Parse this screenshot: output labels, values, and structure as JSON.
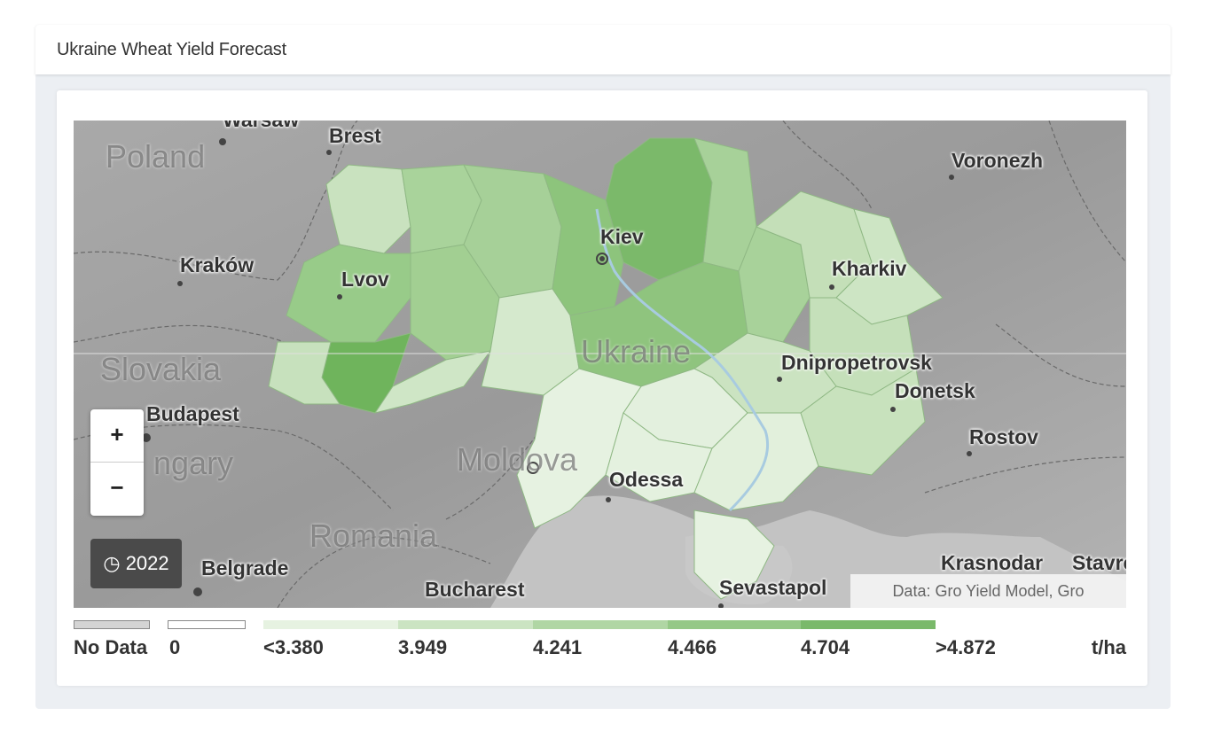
{
  "panel": {
    "title": "Ukraine Wheat Yield Forecast"
  },
  "map": {
    "zoom_in_label": "+",
    "zoom_out_label": "−",
    "year_icon": "clock-icon",
    "year_icon_glyph": "◷",
    "year": "2022",
    "attribution": "Data: Gro Yield Model, Gro",
    "cities": {
      "warsaw": "Warsaw",
      "brest": "Brest",
      "voronezh": "Voronezh",
      "kiev": "Kiev",
      "krakow": "Kraków",
      "lvov": "Lvov",
      "kharkiv": "Kharkiv",
      "dnipropetrovsk": "Dnipropetrovsk",
      "donetsk": "Donetsk",
      "budapest": "Budapest",
      "rostov": "Rostov",
      "odessa": "Odessa",
      "belgrade": "Belgrade",
      "bucharest": "Bucharest",
      "sevastapol": "Sevastapol",
      "krasnodar": "Krasnodar",
      "stavropol": "Stavrc"
    },
    "countries": {
      "poland": "Poland",
      "slovakia": "Slovakia",
      "hungary": "ngary",
      "ukraine": "Ukraine",
      "moldova": "Moldova",
      "romania": "Romania"
    }
  },
  "legend": {
    "no_data_label": "No Data",
    "zero_label": "0",
    "unit": "t/ha",
    "no_data_color": "#d4d4d4",
    "zero_color": "#ffffff",
    "bins": [
      {
        "label": "<3.380",
        "color": "#e6f2e1"
      },
      {
        "label": "3.949",
        "color": "#cbe4c2"
      },
      {
        "label": "4.241",
        "color": "#b0d6a4"
      },
      {
        "label": "4.466",
        "color": "#95c887"
      },
      {
        "label": "4.704",
        "color": "#7ab96a",
        "width_note": ""
      },
      {
        "label": ">4.872",
        "color": ""
      }
    ]
  }
}
